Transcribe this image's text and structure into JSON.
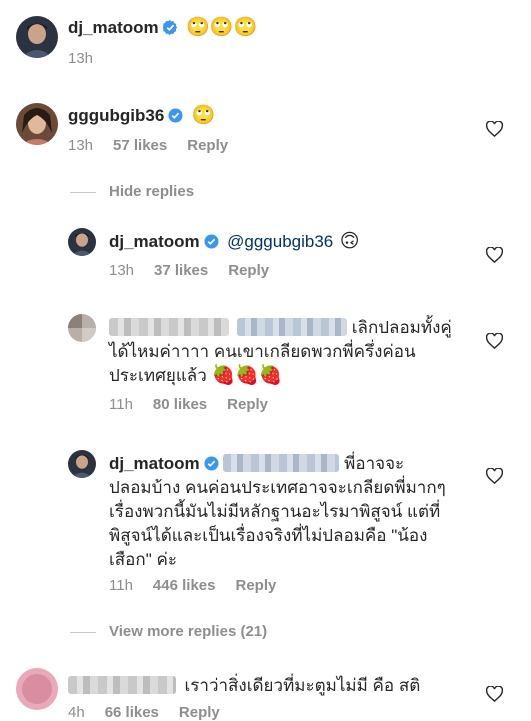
{
  "caption": {
    "username": "dj_matoom",
    "emojis": "🙄🙄🙄",
    "time": "13h"
  },
  "comment1": {
    "username": "gggubgib36",
    "emoji": "🙄",
    "time": "13h",
    "likes": "57 likes",
    "reply": "Reply"
  },
  "hide_replies": "Hide replies",
  "reply1": {
    "username": "dj_matoom",
    "mention": "@gggubgib36",
    "emoji": "🙃",
    "time": "13h",
    "likes": "37 likes",
    "reply": "Reply"
  },
  "reply2": {
    "text_line1": "เลิกปลอมทั้งคู่",
    "text_line2": "ได้ไหมค่าาาา คนเขาเกลียดพวกพี่ครึ่งค่อน",
    "text_line3": "ประเทศยุแล้ว",
    "emojis": "🍓🍓🍓",
    "time": "11h",
    "likes": "80 likes",
    "reply": "Reply"
  },
  "reply3": {
    "username": "dj_matoom",
    "text_line1": "พี่อาจจะ",
    "text_line2": "ปลอมบ้าง คนค่อนประเทศอาจจะเกลียดพี่มากๆ",
    "text_line3": "เรื่องพวกนี้มันไม่มีหลักฐานอะไรมาพิสูจน์ แต่ที่",
    "text_line4": "พิสูจน์ได้และเป็นเรื่องจริงที่ไม่ปลอมคือ \"น้อง",
    "text_line5": "เสือก\" ค่ะ",
    "time": "11h",
    "likes": "446 likes",
    "reply": "Reply"
  },
  "view_more": "View more replies (21)",
  "comment2": {
    "text": "เราว่าสิ่งเดียวที่มะตูมไม่มี คือ สติ",
    "time": "4h",
    "likes": "66 likes",
    "reply": "Reply"
  },
  "colors": {
    "verified": "#3897f0",
    "muted": "#8e8e8e",
    "mention": "#003569"
  },
  "icons": [
    "verified-badge-icon",
    "heart-outline-icon"
  ]
}
